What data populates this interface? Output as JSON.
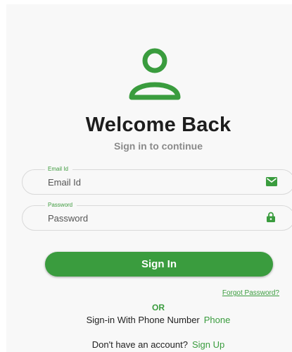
{
  "header": {
    "title": "Welcome Back",
    "subtitle": "Sign in to continue"
  },
  "email": {
    "label": "Email Id",
    "placeholder": "Email Id",
    "icon": "mail-icon"
  },
  "password": {
    "label": "Password",
    "placeholder": "Password",
    "icon": "lock-icon"
  },
  "actions": {
    "signin_label": "Sign In",
    "forgot_label": "Forgot Password?",
    "or_label": "OR",
    "phone_prompt": "Sign-in With Phone Number",
    "phone_link": "Phone",
    "signup_prompt": "Don't have an account?",
    "signup_link": "Sign Up"
  },
  "colors": {
    "accent": "#3a9c3e",
    "background": "#f8f8f8",
    "title": "#1d1d1d",
    "subtitle": "#8a8a8a"
  }
}
